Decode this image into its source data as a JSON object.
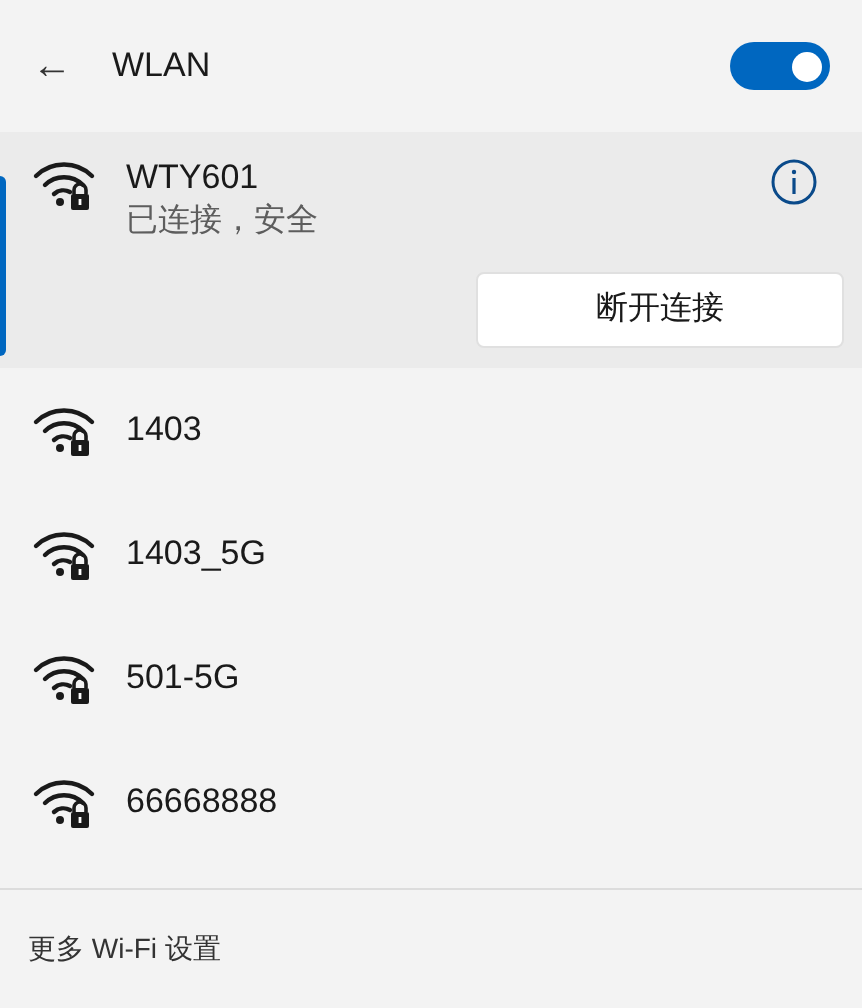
{
  "header": {
    "back": "←",
    "title": "WLAN",
    "on": true
  },
  "networks": [
    {
      "name": "WTY601",
      "status": "已连接，安全",
      "secured": true,
      "selected": true,
      "action": "断开连接"
    },
    {
      "name": "1403",
      "secured": true,
      "selected": false
    },
    {
      "name": "1403_5G",
      "secured": true,
      "selected": false
    },
    {
      "name": "501-5G",
      "secured": true,
      "selected": false
    },
    {
      "name": "66668888",
      "secured": true,
      "selected": false
    }
  ],
  "footer": {
    "link": "更多 Wi-Fi 设置"
  }
}
